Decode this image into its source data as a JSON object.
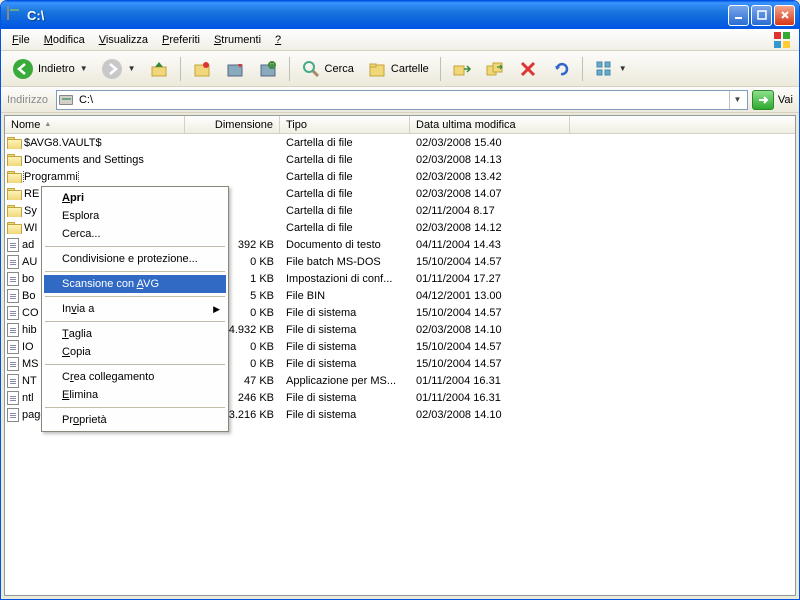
{
  "titlebar": {
    "title": "C:\\"
  },
  "menubar": {
    "file": "File",
    "edit": "Modifica",
    "view": "Visualizza",
    "favorites": "Preferiti",
    "tools": "Strumenti",
    "help": "?"
  },
  "toolbar": {
    "back": "Indietro",
    "search": "Cerca",
    "folders": "Cartelle"
  },
  "addressbar": {
    "label": "Indirizzo",
    "value": "C:\\",
    "go": "Vai"
  },
  "columns": {
    "name": "Nome",
    "size": "Dimensione",
    "type": "Tipo",
    "modified": "Data ultima modifica"
  },
  "rows": [
    {
      "icon": "folder",
      "name": "$AVG8.VAULT$",
      "size": "",
      "type": "Cartella di file",
      "date": "02/03/2008 15.40"
    },
    {
      "icon": "folder",
      "name": "Documents and Settings",
      "size": "",
      "type": "Cartella di file",
      "date": "02/03/2008 14.13"
    },
    {
      "icon": "folder",
      "name": "Programmi",
      "size": "",
      "type": "Cartella di file",
      "date": "02/03/2008 13.42",
      "selected": true
    },
    {
      "icon": "folder",
      "name": "RE",
      "size": "",
      "type": "Cartella di file",
      "date": "02/03/2008 14.07"
    },
    {
      "icon": "folder",
      "name": "Sy",
      "size": "",
      "type": "Cartella di file",
      "date": "02/11/2004 8.17"
    },
    {
      "icon": "folder",
      "name": "WI",
      "size": "",
      "type": "Cartella di file",
      "date": "02/03/2008 14.12"
    },
    {
      "icon": "file",
      "name": "ad",
      "size": "392 KB",
      "type": "Documento di testo",
      "date": "04/11/2004 14.43"
    },
    {
      "icon": "file",
      "name": "AU",
      "size": "0 KB",
      "type": "File batch MS-DOS",
      "date": "15/10/2004 14.57"
    },
    {
      "icon": "file",
      "name": "bo",
      "size": "1 KB",
      "type": "Impostazioni di conf...",
      "date": "01/11/2004 17.27"
    },
    {
      "icon": "file",
      "name": "Bo",
      "size": "5 KB",
      "type": "File BIN",
      "date": "04/12/2001 13.00"
    },
    {
      "icon": "file",
      "name": "CO",
      "size": "0 KB",
      "type": "File di sistema",
      "date": "15/10/2004 14.57"
    },
    {
      "icon": "file",
      "name": "hib",
      "size": "314.932 KB",
      "type": "File di sistema",
      "date": "02/03/2008 14.10"
    },
    {
      "icon": "file",
      "name": "IO",
      "size": "0 KB",
      "type": "File di sistema",
      "date": "15/10/2004 14.57"
    },
    {
      "icon": "file",
      "name": "MS",
      "size": "0 KB",
      "type": "File di sistema",
      "date": "15/10/2004 14.57"
    },
    {
      "icon": "file",
      "name": "NT",
      "size": "47 KB",
      "type": "Applicazione per MS...",
      "date": "01/11/2004 16.31"
    },
    {
      "icon": "file",
      "name": "ntl",
      "size": "246 KB",
      "type": "File di sistema",
      "date": "01/11/2004 16.31"
    },
    {
      "icon": "file",
      "name": "pagefile.sys",
      "size": "393.216 KB",
      "type": "File di sistema",
      "date": "02/03/2008 14.10"
    }
  ],
  "contextMenu": {
    "open": "Apri",
    "explore": "Esplora",
    "searchItem": "Cerca...",
    "shareSecurity": "Condivisione e protezione...",
    "avgScan": "Scansione con AVG",
    "sendTo": "Invia a",
    "cut": "Taglia",
    "copy": "Copia",
    "createShortcut": "Crea collegamento",
    "delete": "Elimina",
    "properties": "Proprietà"
  }
}
